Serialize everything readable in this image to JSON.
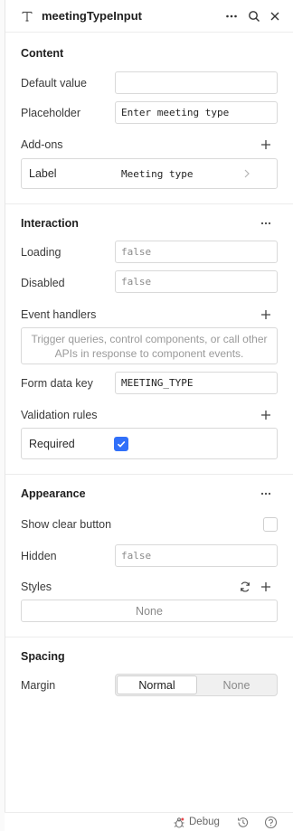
{
  "header": {
    "title": "meetingTypeInput",
    "type_icon": "text-type-icon",
    "actions": [
      "more-icon",
      "search-icon",
      "close-icon"
    ]
  },
  "content": {
    "section_title": "Content",
    "default_value_label": "Default value",
    "default_value": "",
    "placeholder_label": "Placeholder",
    "placeholder_value": "Enter meeting type",
    "addons_label": "Add-ons",
    "addon_row_label": "Label",
    "addon_row_value": "Meeting type"
  },
  "interaction": {
    "section_title": "Interaction",
    "loading_label": "Loading",
    "loading_value": "false",
    "disabled_label": "Disabled",
    "disabled_value": "false",
    "event_handlers_label": "Event handlers",
    "event_handlers_empty": "Trigger queries, control components, or call other APIs in response to component events.",
    "form_data_key_label": "Form data key",
    "form_data_key_value": "MEETING_TYPE",
    "validation_rules_label": "Validation rules",
    "required_label": "Required",
    "required_checked": true
  },
  "appearance": {
    "section_title": "Appearance",
    "show_clear_button_label": "Show clear button",
    "show_clear_button_checked": false,
    "hidden_label": "Hidden",
    "hidden_value": "false",
    "styles_label": "Styles",
    "styles_value": "None"
  },
  "spacing": {
    "section_title": "Spacing",
    "margin_label": "Margin",
    "margin_options": [
      "Normal",
      "None"
    ],
    "margin_selected": "Normal"
  },
  "footer": {
    "debug_label": "Debug"
  },
  "colors": {
    "accent": "#3170f9",
    "border": "#d9d9d9",
    "divider": "#ececec"
  }
}
